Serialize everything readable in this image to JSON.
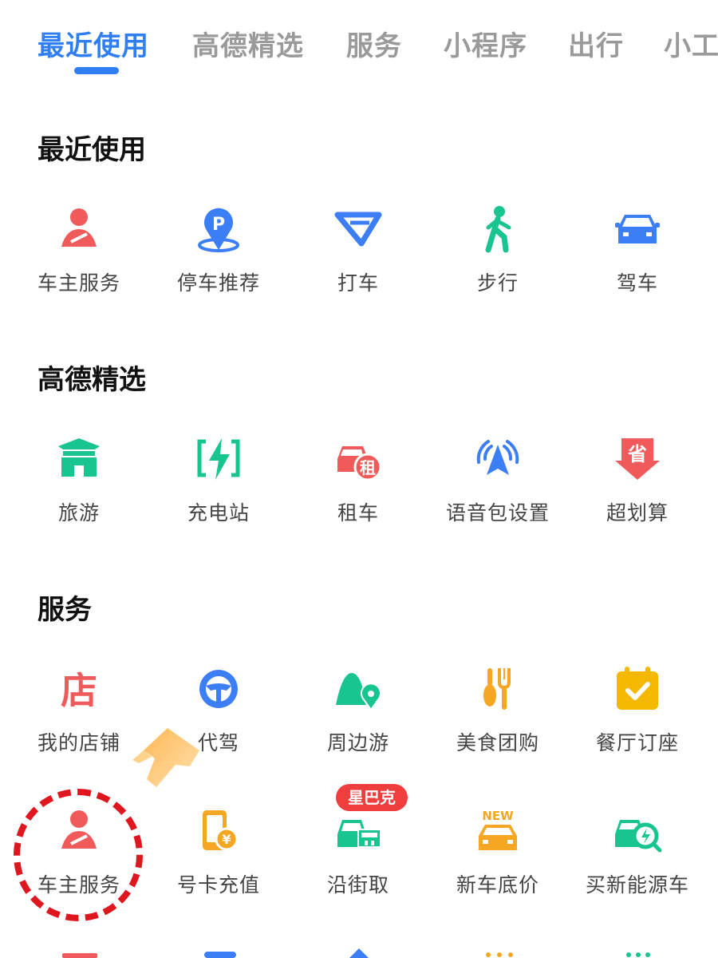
{
  "tabs": [
    {
      "label": "最近使用"
    },
    {
      "label": "高德精选"
    },
    {
      "label": "服务"
    },
    {
      "label": "小程序"
    },
    {
      "label": "出行"
    },
    {
      "label": "小工"
    }
  ],
  "sections": {
    "recent": {
      "title": "最近使用",
      "items": [
        {
          "label": "车主服务",
          "icon": "car-owner-icon"
        },
        {
          "label": "停车推荐",
          "icon": "parking-icon"
        },
        {
          "label": "打车",
          "icon": "taxi-icon"
        },
        {
          "label": "步行",
          "icon": "walk-icon"
        },
        {
          "label": "驾车",
          "icon": "car-icon"
        }
      ]
    },
    "featured": {
      "title": "高德精选",
      "items": [
        {
          "label": "旅游",
          "icon": "travel-icon"
        },
        {
          "label": "充电站",
          "icon": "charging-station-icon"
        },
        {
          "label": "租车",
          "icon": "car-rental-icon"
        },
        {
          "label": "语音包设置",
          "icon": "voice-pack-icon"
        },
        {
          "label": "超划算",
          "icon": "deal-icon"
        }
      ]
    },
    "services": {
      "title": "服务",
      "row1": [
        {
          "label": "我的店铺",
          "icon": "shop-icon"
        },
        {
          "label": "代驾",
          "icon": "steering-wheel-icon"
        },
        {
          "label": "周边游",
          "icon": "nearby-travel-icon"
        },
        {
          "label": "美食团购",
          "icon": "food-icon"
        },
        {
          "label": "餐厅订座",
          "icon": "restaurant-booking-icon"
        }
      ],
      "row2": [
        {
          "label": "车主服务",
          "icon": "car-owner-icon"
        },
        {
          "label": "号卡充值",
          "icon": "phone-recharge-icon"
        },
        {
          "label": "沿街取",
          "icon": "curbside-pickup-icon"
        },
        {
          "label": "新车底价",
          "icon": "new-car-price-icon"
        },
        {
          "label": "买新能源车",
          "icon": "ev-car-icon"
        }
      ],
      "badge": "星巴克",
      "new_tag": "NEW",
      "shop_glyph": "店",
      "deal_glyph": "省",
      "rent_glyph": "租",
      "parking_glyph": "P",
      "yen_glyph": "¥"
    }
  },
  "colors": {
    "accent": "#2f7ff2",
    "red": "#f05a5a",
    "green": "#18c48f",
    "orange": "#f5a623",
    "blue": "#3b7ef5"
  }
}
